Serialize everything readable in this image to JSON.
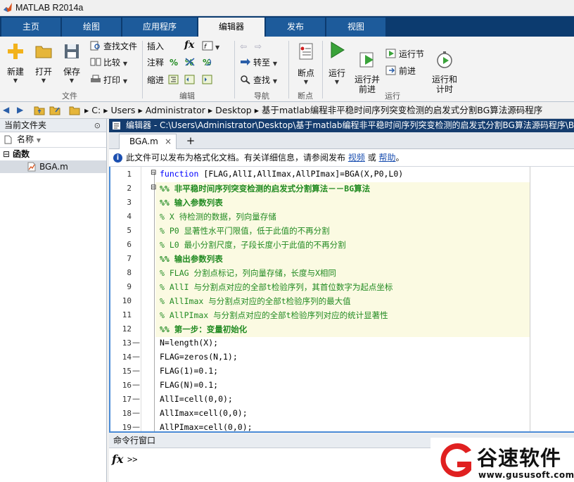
{
  "app": {
    "title": "MATLAB R2014a"
  },
  "tabs": [
    {
      "label": "主页"
    },
    {
      "label": "绘图"
    },
    {
      "label": "应用程序"
    },
    {
      "label": "编辑器"
    },
    {
      "label": "发布"
    },
    {
      "label": "视图"
    }
  ],
  "ribbon": {
    "new_label": "新建",
    "open_label": "打开",
    "save_label": "保存",
    "find_files_label": "查找文件",
    "compare_label": "比较",
    "print_label": "打印",
    "insert_label": "插入",
    "fx_label": "fx",
    "comment_label": "注释",
    "indent_label": "缩进",
    "goto_label": "转至",
    "find_label": "查找",
    "breakpoint_label": "断点",
    "run_label": "运行",
    "run_advance_label": "运行并\n前进",
    "run_section_label": "运行节",
    "advance_label": "前进",
    "run_time_label": "运行和\n计时",
    "groups": {
      "file": "文件",
      "edit": "编辑",
      "navigate": "导航",
      "breakpoints": "断点",
      "run": "运行"
    }
  },
  "address": {
    "segments": [
      "C:",
      "Users",
      "Administrator",
      "Desktop",
      "基于matlab编程非平稳时间序列突变检测的启发式分割BG算法源码程序"
    ]
  },
  "current_folder": {
    "title": "当前文件夹",
    "column_name": "名称",
    "group_label": "函数",
    "files": [
      "BGA.m"
    ]
  },
  "editor": {
    "header": "编辑器 - C:\\Users\\Administrator\\Desktop\\基于matlab编程非平稳时间序列突变检测的启发式分割BG算法源码程序\\BGA.m",
    "file_tab": "BGA.m",
    "close_glyph": "×",
    "add_glyph": "+",
    "info_text": "此文件可以发布为格式化文档。有关详细信息，请参阅发布",
    "info_link1": "视频",
    "info_or": "或",
    "info_link2": "帮助",
    "info_end": "。",
    "lines": [
      {
        "n": "1",
        "dash": "",
        "kind": "fn",
        "kw": "function",
        "text": " [FLAG,AllI,AllImax,AllPImax]=BGA(X,P0,L0)"
      },
      {
        "n": "2",
        "dash": "",
        "kind": "cc",
        "text": "%% 非平稳时间序列突变检测的启发式分割算法－－BG算法"
      },
      {
        "n": "3",
        "dash": "",
        "kind": "cc",
        "text": "%% 输入参数列表"
      },
      {
        "n": "4",
        "dash": "",
        "kind": "c",
        "text": "% X           待检测的数据，列向量存储"
      },
      {
        "n": "5",
        "dash": "",
        "kind": "c",
        "text": "% P0          显著性水平门限值，低于此值的不再分割"
      },
      {
        "n": "6",
        "dash": "",
        "kind": "c",
        "text": "% L0          最小分割尺度，子段长度小于此值的不再分割"
      },
      {
        "n": "7",
        "dash": "",
        "kind": "cc",
        "text": "%% 输出参数列表"
      },
      {
        "n": "8",
        "dash": "",
        "kind": "c",
        "text": "% FLAG        分割点标记，列向量存储，长度与X相同"
      },
      {
        "n": "9",
        "dash": "",
        "kind": "c",
        "text": "% AllI        与分割点对应的全部t检验序列，其首位数字为起点坐标"
      },
      {
        "n": "10",
        "dash": "",
        "kind": "c",
        "text": "% AllImax     与分割点对应的全部t检验序列的最大值"
      },
      {
        "n": "11",
        "dash": "",
        "kind": "c",
        "text": "% AllPImax    与分割点对应的全部t检验序列对应的统计显著性"
      },
      {
        "n": "12",
        "dash": "",
        "kind": "cc",
        "text": "%% 第一步：变量初始化"
      },
      {
        "n": "13",
        "dash": "—",
        "kind": "p",
        "text": "N=length(X);"
      },
      {
        "n": "14",
        "dash": "—",
        "kind": "p",
        "text": "FLAG=zeros(N,1);"
      },
      {
        "n": "15",
        "dash": "—",
        "kind": "p",
        "text": "FLAG(1)=0.1;"
      },
      {
        "n": "16",
        "dash": "—",
        "kind": "p",
        "text": "FLAG(N)=0.1;"
      },
      {
        "n": "17",
        "dash": "—",
        "kind": "p",
        "text": "AllI=cell(0,0);"
      },
      {
        "n": "18",
        "dash": "—",
        "kind": "p",
        "text": "AllImax=cell(0,0);"
      },
      {
        "n": "19",
        "dash": "—",
        "kind": "p",
        "text": "AllPImax=cell(0,0);"
      }
    ]
  },
  "command_window": {
    "title": "命令行窗口",
    "fx_label": "fx",
    "prompt": ">>"
  },
  "watermark": {
    "brand": "谷速软件",
    "url": "www.gususoft.com"
  },
  "colors": {
    "tab_bar": "#0c3b6f",
    "tab_inactive": "#1d5b9b",
    "editor_header": "#143c6e",
    "cell_bg": "#fbfae2",
    "comment": "#228b22",
    "keyword": "#0000ff",
    "brand_red": "#e02020"
  }
}
